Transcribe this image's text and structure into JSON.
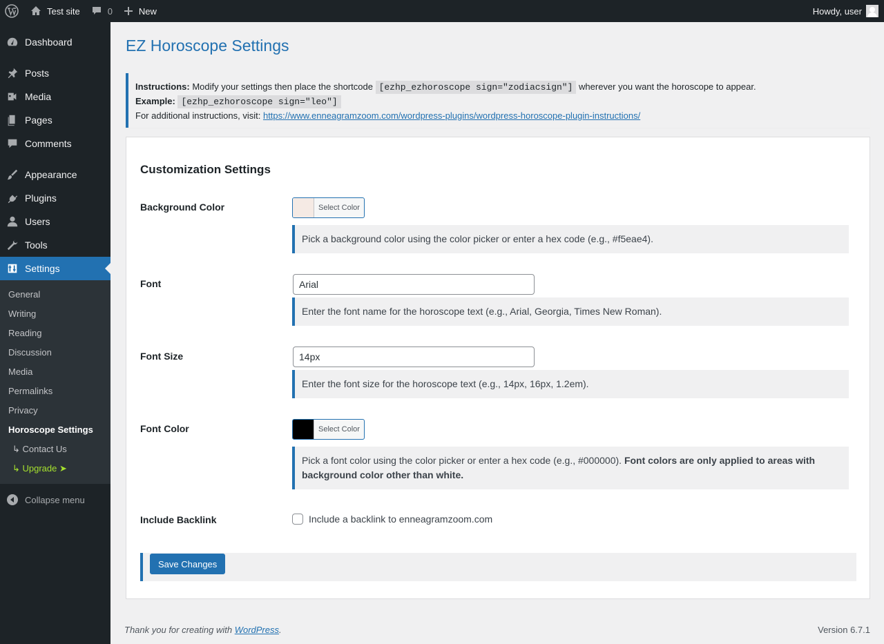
{
  "adminbar": {
    "site_name": "Test site",
    "comments_count": "0",
    "new_label": "New",
    "howdy": "Howdy, user"
  },
  "sidebar": {
    "items": [
      {
        "label": "Dashboard",
        "icon": "dashboard-icon"
      },
      {
        "label": "Posts",
        "icon": "pin-icon"
      },
      {
        "label": "Media",
        "icon": "media-icon"
      },
      {
        "label": "Pages",
        "icon": "pages-icon"
      },
      {
        "label": "Comments",
        "icon": "comments-icon"
      },
      {
        "label": "Appearance",
        "icon": "paintbrush-icon"
      },
      {
        "label": "Plugins",
        "icon": "plugin-icon"
      },
      {
        "label": "Users",
        "icon": "users-icon"
      },
      {
        "label": "Tools",
        "icon": "wrench-icon"
      },
      {
        "label": "Settings",
        "icon": "settings-icon"
      }
    ],
    "submenu": [
      "General",
      "Writing",
      "Reading",
      "Discussion",
      "Media",
      "Permalinks",
      "Privacy",
      "Horoscope Settings",
      "↳ Contact Us",
      "↳ Upgrade ➤"
    ],
    "collapse": "Collapse menu"
  },
  "page": {
    "title": "EZ Horoscope Settings"
  },
  "notice": {
    "instructions_label": "Instructions:",
    "instructions_text": " Modify your settings then place the shortcode ",
    "shortcode": "[ezhp_ezhoroscope sign=\"zodiacsign\"]",
    "instructions_end": " wherever you want the horoscope to appear.",
    "example_label": "Example:",
    "example_code": "[ezhp_ezhoroscope sign=\"leo\"]",
    "additional_text": "For additional instructions, visit: ",
    "link": "https://www.enneagramzoom.com/wordpress-plugins/wordpress-horoscope-plugin-instructions/"
  },
  "settings": {
    "heading": "Customization Settings",
    "bg_color": {
      "label": "Background Color",
      "button": "Select Color",
      "swatch": "#f5eae4",
      "desc": "Pick a background color using the color picker or enter a hex code (e.g., #f5eae4)."
    },
    "font": {
      "label": "Font",
      "value": "Arial",
      "desc": "Enter the font name for the horoscope text (e.g., Arial, Georgia, Times New Roman)."
    },
    "font_size": {
      "label": "Font Size",
      "value": "14px",
      "desc": "Enter the font size for the horoscope text (e.g., 14px, 16px, 1.2em)."
    },
    "font_color": {
      "label": "Font Color",
      "button": "Select Color",
      "swatch": "#000000",
      "desc": "Pick a font color using the color picker or enter a hex code (e.g., #000000). ",
      "desc_bold": "Font colors are only applied to areas with background color other than white."
    },
    "backlink": {
      "label": "Include Backlink",
      "checkbox_label": "Include a backlink to enneagramzoom.com"
    },
    "save": "Save Changes"
  },
  "footer": {
    "thanks": "Thank you for creating with ",
    "wp_link": "WordPress",
    "period": ".",
    "version": "Version 6.7.1"
  },
  "colors": {
    "accent": "#2271b1",
    "adminbar_bg": "#1d2327"
  }
}
